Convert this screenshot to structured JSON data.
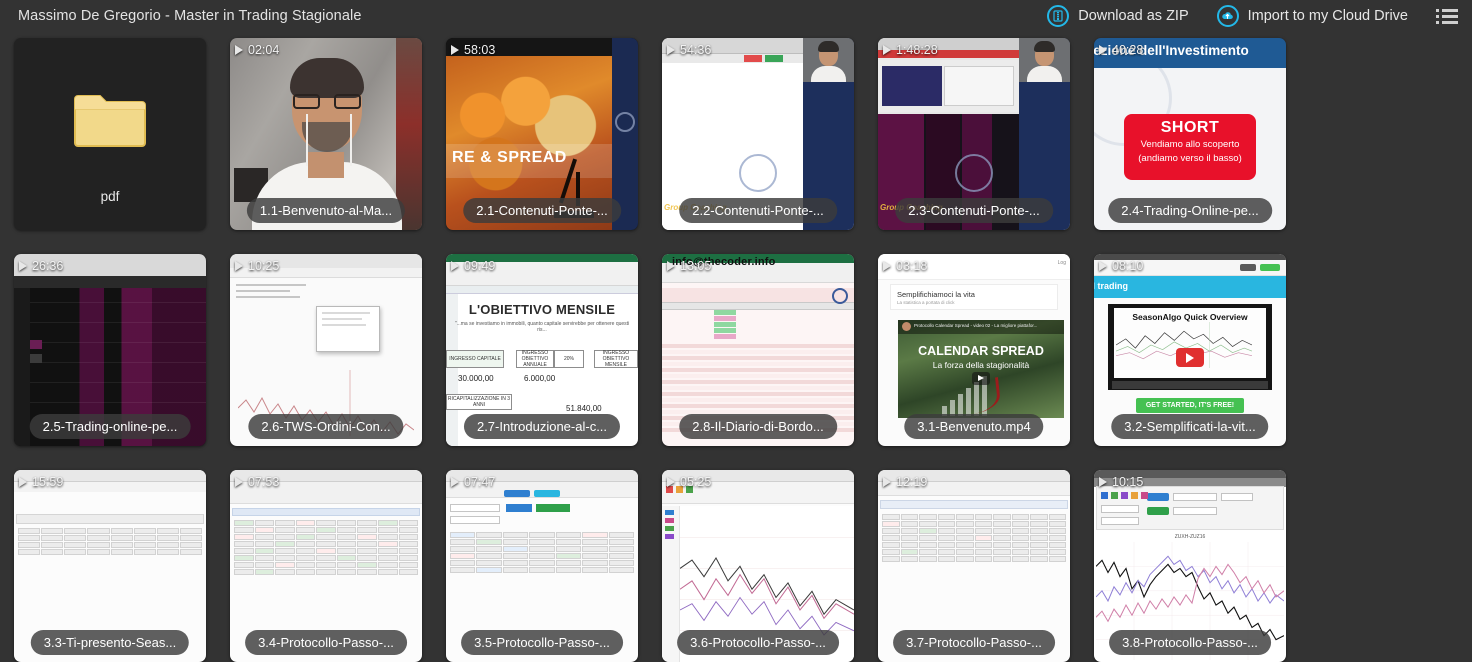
{
  "header": {
    "title": "Massimo De Gregorio - Master in Trading Stagionale",
    "download_zip_label": "Download as ZIP",
    "import_cloud_label": "Import to my Cloud Drive",
    "accent_color": "#23b8e8",
    "background_color": "#333333",
    "icons": {
      "zip": "zip-file-icon",
      "cloud": "cloud-upload-icon",
      "list": "list-view-icon"
    }
  },
  "grid": {
    "folder": {
      "name": "pdf",
      "icon": "folder-icon",
      "color": "#f5d37a"
    },
    "rows": [
      [
        {
          "duration": "02:04",
          "title": "1.1-Benvenuto-al-Ma...",
          "kind": "webcam-portrait"
        },
        {
          "duration": "58:03",
          "title": "2.1-Contenuti-Ponte-...",
          "kind": "commodities-slide",
          "overlay_text": "RE & SPREAD"
        },
        {
          "duration": "54:36",
          "title": "2.2-Contenuti-Ponte-...",
          "kind": "screenshare-navy"
        },
        {
          "duration": "1:48:28",
          "title": "2.3-Contenuti-Ponte-...",
          "kind": "screenshare-terminal"
        },
        {
          "duration": "40:28",
          "title": "2.4-Trading-Online-pe...",
          "kind": "short-slide",
          "slide_header": "rezione dell'Investimento",
          "slide_box_title": "SHORT",
          "slide_box_line1": "Vendiamo allo scoperto",
          "slide_box_line2": "(andiamo verso il basso)",
          "slide_box_color": "#e8112a"
        }
      ],
      [
        {
          "duration": "26:36",
          "title": "2.5-Trading-online-pe...",
          "kind": "dark-terminal"
        },
        {
          "duration": "10:25",
          "title": "2.6-TWS-Ordini-Con...",
          "kind": "tws-light"
        },
        {
          "duration": "09:49",
          "title": "2.7-Introduzione-al-c...",
          "kind": "excel-objective",
          "sheet_title": "L'OBIETTIVO MENSILE",
          "sheet_subtitle": "\"...ma se investiamo in immobili, quanto capitale servirebbe per ottenere questi ris...",
          "cells": [
            {
              "label": "INGRESSO CAPITALE",
              "value": "30.000,00"
            },
            {
              "label": "INGRESSO OBIETTIVO ANNUALE",
              "value": "6.000,00"
            },
            {
              "label": "20%",
              "value": ""
            },
            {
              "label": "INGRESSO OBIETTIVO MENSILE",
              "value": ""
            },
            {
              "label": "RICAPITALIZZAZIONE IN 3 ANNI",
              "value": "51.840,00"
            }
          ]
        },
        {
          "duration": "13:05",
          "title": "2.8-Il-Diario-di-Bordo...",
          "kind": "diary-sheet",
          "watermark": "info@thecoder.info"
        },
        {
          "duration": "03:18",
          "title": "3.1-Benvenuto.mp4",
          "kind": "calendar-spread-page",
          "page_title": "Semplifichiamoci la vita",
          "page_subtitle": "La statistica a portata di click",
          "video_title": "CALENDAR SPREAD",
          "video_subtitle": "La forza della stagionalità",
          "video_meta": "Protocollo Calendar Spread - video 02 - La migliore piattafor..."
        },
        {
          "duration": "08:10",
          "title": "3.2-Semplificati-la-vit...",
          "kind": "seasonalgo-site",
          "hero_text": "nal trading",
          "video_title": "SeasonAlgo Quick Overview",
          "cta_label": "GET STARTED, IT'S FREE!"
        }
      ],
      [
        {
          "duration": "15:59",
          "title": "3.3-Ti-presento-Seas...",
          "kind": "data-table"
        },
        {
          "duration": "07:53",
          "title": "3.4-Protocollo-Passo-...",
          "kind": "data-table-dense"
        },
        {
          "duration": "07:47",
          "title": "3.5-Protocollo-Passo-...",
          "kind": "data-table-form"
        },
        {
          "duration": "05:25",
          "title": "3.6-Protocollo-Passo-...",
          "kind": "chart-panel"
        },
        {
          "duration": "12:19",
          "title": "3.7-Protocollo-Passo-...",
          "kind": "data-table-wide"
        },
        {
          "duration": "10:15",
          "title": "3.8-Protocollo-Passo-...",
          "kind": "seasonal-chart",
          "chart_label": "ZUXH-ZUZ16"
        }
      ]
    ]
  }
}
